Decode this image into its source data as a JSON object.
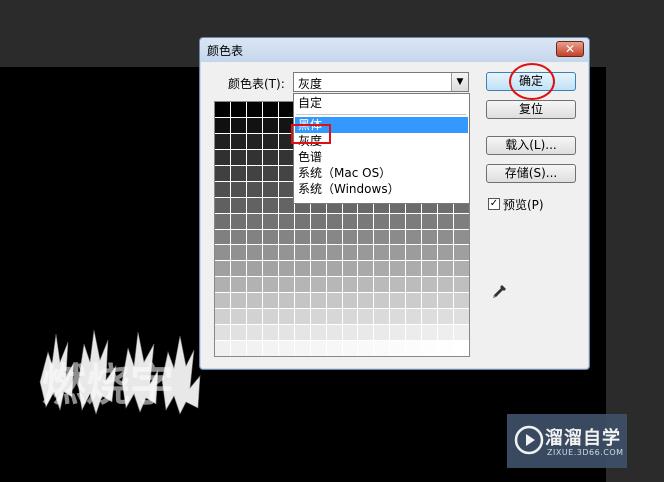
{
  "dialog": {
    "title": "颜色表",
    "close_label": "✕",
    "table_label": "颜色表(T):",
    "selected_table": "灰度",
    "dropdown_options": [
      {
        "label": "自定"
      },
      {
        "label": "黑体"
      },
      {
        "label": "灰度"
      },
      {
        "label": "色谱"
      },
      {
        "label": "系统（Mac OS）"
      },
      {
        "label": "系统（Windows）"
      }
    ],
    "highlighted_option": "黑体",
    "buttons": {
      "ok": "确定",
      "reset": "复位",
      "load": "载入(L)...",
      "save": "存储(S)..."
    },
    "preview": {
      "label": "预览(P)",
      "checked": true,
      "checkmark": "✓"
    }
  },
  "canvas": {
    "fire_text": "燃烧字"
  },
  "watermark": {
    "title": "溜溜自学",
    "url": "ZIXUE.3D66.COM"
  },
  "colors": {
    "highlight": "#3399ff",
    "annotation_red": "#dd1111",
    "watermark_bg": "#3d4f66"
  }
}
